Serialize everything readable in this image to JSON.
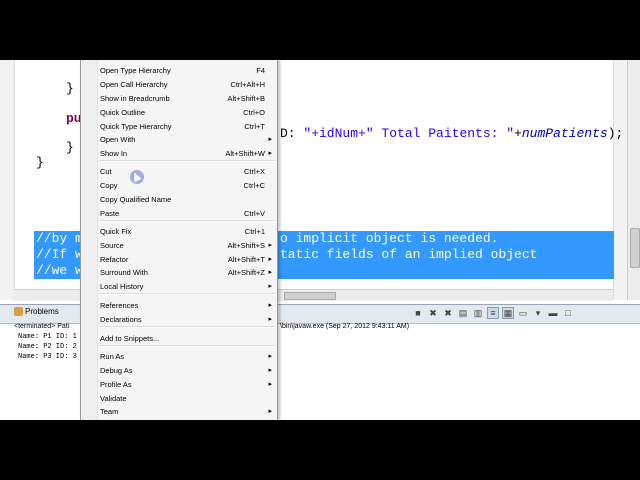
{
  "editor": {
    "code_lines": [
      {
        "text": "}"
      },
      {
        "text": "pu"
      },
      {
        "text": "}"
      },
      {
        "text": "}"
      }
    ],
    "visible_string_line": {
      "pre": "D: ",
      "s1": "\"+idNum+\"",
      "s2": " Total Paitents: \"",
      "plus": "+",
      "var": "numPatients",
      "end": ");"
    },
    "selected_lines": [
      {
        "left": "//by m",
        "right": "o implicit object is needed."
      },
      {
        "left": "//If w",
        "right": "tatic fields of an implied object"
      },
      {
        "left": "//we w",
        "right": ""
      }
    ]
  },
  "panel": {
    "problems_tab": "Problems",
    "status_left": "<terminated> Pati",
    "status_right": "\\bin\\javaw.exe (Sep 27, 2012 9:43:11 AM)",
    "console_lines": [
      "Name: P1 ID: 1",
      "Name: P2 ID: 2",
      "Name: P3 ID: 3"
    ],
    "toolbar_icons": [
      "stop-icon",
      "remove-icon",
      "remove-all-icon",
      "scroll-lock-icon",
      "pin-icon",
      "word-wrap-icon",
      "display-icon",
      "new-console-icon",
      "view-menu-icon",
      "minimize-icon",
      "maximize-icon"
    ]
  },
  "menu": {
    "items": [
      {
        "label": "Open Type Hierarchy",
        "acc": "F4",
        "sub": false
      },
      {
        "label": "Open Call Hierarchy",
        "acc": "Ctrl+Alt+H",
        "sub": false
      },
      {
        "label": "Show in Breadcrumb",
        "acc": "Alt+Shift+B",
        "sub": false
      },
      {
        "label": "Quick Outline",
        "acc": "Ctrl+O",
        "sub": false
      },
      {
        "label": "Quick Type Hierarchy",
        "acc": "Ctrl+T",
        "sub": false
      },
      {
        "label": "Open With",
        "acc": "",
        "sub": true
      },
      {
        "label": "Show In",
        "acc": "Alt+Shift+W",
        "sub": true
      },
      {
        "label": "Cut",
        "acc": "Ctrl+X",
        "sub": false
      },
      {
        "label": "Copy",
        "acc": "Ctrl+C",
        "sub": false
      },
      {
        "label": "Copy Qualified Name",
        "acc": "",
        "sub": false
      },
      {
        "label": "Paste",
        "acc": "Ctrl+V",
        "sub": false
      },
      {
        "label": "Quick Fix",
        "acc": "Ctrl+1",
        "sub": false
      },
      {
        "label": "Source",
        "acc": "Alt+Shift+S",
        "sub": true
      },
      {
        "label": "Refactor",
        "acc": "Alt+Shift+T",
        "sub": true
      },
      {
        "label": "Surround With",
        "acc": "Alt+Shift+Z",
        "sub": true
      },
      {
        "label": "Local History",
        "acc": "",
        "sub": true
      },
      {
        "label": "References",
        "acc": "",
        "sub": true
      },
      {
        "label": "Declarations",
        "acc": "",
        "sub": true
      },
      {
        "label": "Add to Snippets...",
        "acc": "",
        "sub": false
      },
      {
        "label": "Run As",
        "acc": "",
        "sub": true
      },
      {
        "label": "Debug As",
        "acc": "",
        "sub": true
      },
      {
        "label": "Profile As",
        "acc": "",
        "sub": true
      },
      {
        "label": "Validate",
        "acc": "",
        "sub": false
      },
      {
        "label": "Team",
        "acc": "",
        "sub": true
      }
    ],
    "submenu_arrow": "▸"
  }
}
